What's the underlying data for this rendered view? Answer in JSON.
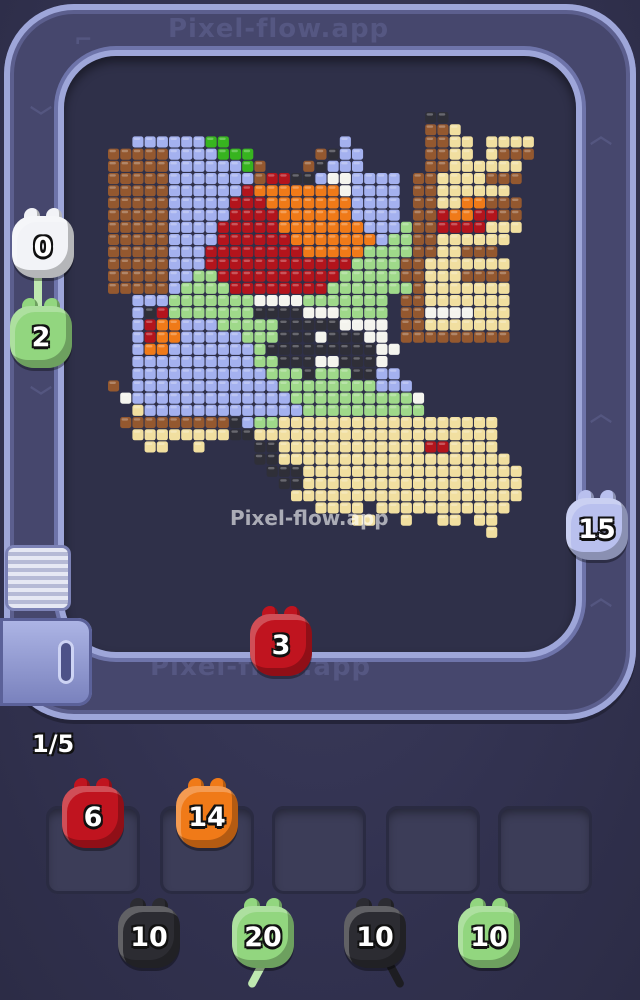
{
  "game": {
    "rail_watermark": "Pixel-flow.app",
    "rail_watermark_bottom": "Pixel-flow.app",
    "center_watermark": "Pixel-flow.app",
    "queue_counter": "1/5"
  },
  "palette": {
    "r": "#b3141c",
    "d": "#6e0a12",
    "o": "#f07a18",
    "y": "#f1dfa0",
    "b": "#a4b1ef",
    "g": "#9fd98a",
    "G": "#37b41f",
    "k": "#2f2f38",
    "w": "#f4f4ee",
    "n": "#94582f",
    "m": "#5c3018",
    "c": "#c97a2c"
  },
  "pixel_grid": {
    "rows": [
      "..........................kk........",
      "..........................nny.......",
      "..bbbbbbGG.........b......nnyy.yyyy.",
      "nnnnnbbbbGGG.....nkbb.....nnyy.ynnn.",
      "nnnnnbbbbbbGn...nkbbb.....nnyyyyyy..",
      "nnnnnbbbbbbbnrrkkbwwbbbb.nnyyyynnn..",
      "nnnnnbbbbbbrooooooowbbbb.nnyyyyyy...",
      "nnnnnbbbbbrrrooooooobbbb.nnyyoonnn..",
      "nnnnnbbbbbrrrroooooobbbb.nnroorrnn..",
      "nnnnnbbbbrrrrrooooooobbbgnnrrrryyy..",
      "nnnnnbbbbrrrrrrooooooobggnnyyyyyy...",
      "nnnnnbbbrrrrrrrroooooggggnnyynnn....",
      "nnnnnbbbrrrrrrrrrrrrggggnnyyyyyyy...",
      "nnnnnbbggrrrrrrrrrrgggggnnyyynnnn...",
      "nnnnnbggggrrrrrrrrgggggggnyyyyyyy...",
      "..bbbgggggggwwwwggggggg.nnyyyyyyy...",
      "..bkrgggggggkkkkwwwgggg.nnwwwwyyy...",
      "..broobbbgggggkkkkkwwww.nnyyyyyyy...",
      "..broobbbbbgggkkkwkkkww.nnnnnnnnn...",
      "..boobbbbbbbgkkkkkkkkkww............",
      "..bbbbbbbbbbggkkkwwkkkw.............",
      "..bbbbbbbbbbbgggkgggkkbb............",
      "n.bbbbbbbbbbbbggggggggbbb...........",
      ".wbbbbbbbbbbbbbggggggggggw..........",
      "..ybbbbbbbbbbbbbgggggggggg..........",
      ".nnnnnnnnnkbggyyyyyyyyyyyyyyyyyy....",
      "..yyyyyyyykkyyyyyyyyyyyyyyyyyyyy....",
      "...yy..y....kkyyyyyyyyyyyyrryyyy....",
      "............kkyyyyyyyyyyyyyyyyyyy...",
      ".............kkkyyyyyyyyyyyyyyyyyy..",
      "..............kkyyyyyyyyyyyyyyyyyy..",
      "...............yyyyyyyyyyyyyyyyyyy..",
      ".................yyyy.yyyyyyyyyyy...",
      "....................yy..y..yy.yy..",
      "...............................y...."
    ]
  },
  "shooters": [
    {
      "id": "white-pig",
      "count": "0",
      "color": "#f2f3f7",
      "x": 0,
      "y": 0
    },
    {
      "id": "green-pig",
      "count": "2",
      "color": "#92d67f"
    },
    {
      "id": "lavender-pig",
      "count": "15",
      "color": "#b9c0ee"
    },
    {
      "id": "track-red-pig",
      "count": "3",
      "color": "#c0141f"
    }
  ],
  "slots": {
    "filled": [
      {
        "count": "6",
        "color": "#c0141f"
      },
      {
        "count": "14",
        "color": "#f07a18"
      }
    ],
    "empty_count": 3
  },
  "queue": [
    {
      "count": "10",
      "color": "#2c2c32"
    },
    {
      "count": "20",
      "color": "#92d67f"
    },
    {
      "count": "10",
      "color": "#2c2c32"
    },
    {
      "count": "10",
      "color": "#92d67f"
    }
  ]
}
